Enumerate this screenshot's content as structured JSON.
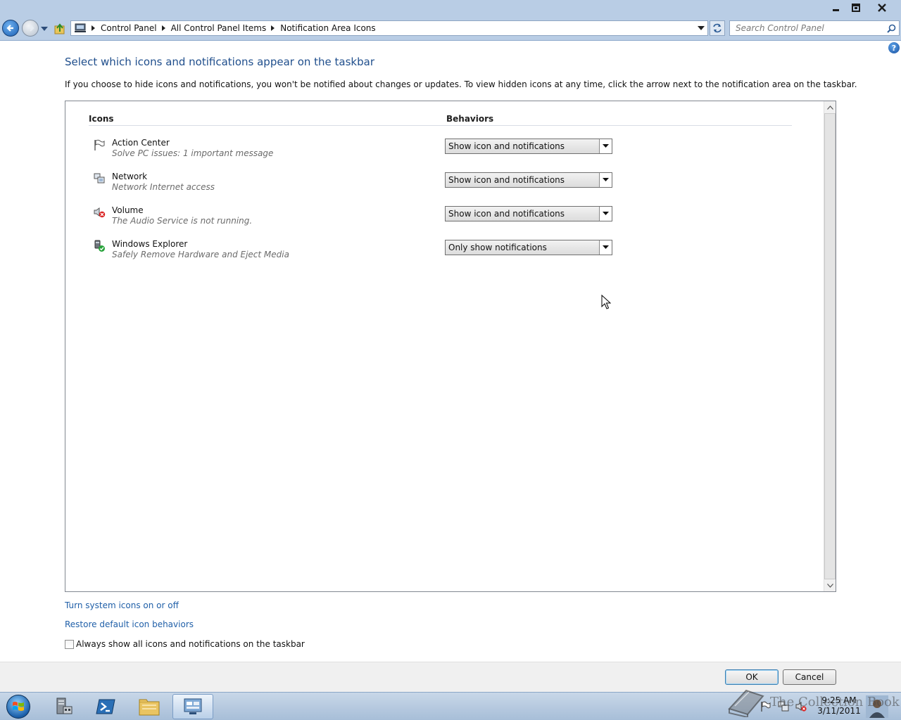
{
  "window": {
    "minimize_icon": "minimize-icon",
    "restore_icon": "restore-icon",
    "close_icon": "close-icon"
  },
  "address_bar": {
    "breadcrumbs": [
      "Control Panel",
      "All Control Panel Items",
      "Notification Area Icons"
    ]
  },
  "search": {
    "placeholder": "Search Control Panel"
  },
  "content": {
    "title": "Select which icons and notifications appear on the taskbar",
    "description": "If you choose to hide icons and notifications, you won't be notified about changes or updates. To view hidden icons at any time, click the arrow next to the notification area on the taskbar."
  },
  "table": {
    "col_icons": "Icons",
    "col_behaviors": "Behaviors",
    "rows": [
      {
        "name": "Action Center",
        "subtitle": "Solve PC issues: 1 important message",
        "behavior": "Show icon and notifications",
        "icon": "flag-icon"
      },
      {
        "name": "Network",
        "subtitle": "Network Internet access",
        "behavior": "Show icon and notifications",
        "icon": "network-icon"
      },
      {
        "name": "Volume",
        "subtitle": "The Audio Service is not running.",
        "behavior": "Show icon and notifications",
        "icon": "volume-muted-icon"
      },
      {
        "name": "Windows Explorer",
        "subtitle": "Safely Remove Hardware and Eject Media",
        "behavior": "Only show notifications",
        "icon": "safely-remove-hardware-icon"
      }
    ]
  },
  "links": {
    "turn_system_icons": "Turn system icons on or off",
    "restore_defaults": "Restore default icon behaviors"
  },
  "checkbox": {
    "label": "Always show all icons and notifications on the taskbar",
    "checked": false
  },
  "buttons": {
    "ok": "OK",
    "cancel": "Cancel"
  },
  "taskbar": {
    "time": "9:25 AM",
    "date": "3/11/2011",
    "watermark": "The Collection Book"
  },
  "colors": {
    "chrome": "#b9cde5",
    "link": "#1f5fa8",
    "title": "#1f4e8c"
  }
}
